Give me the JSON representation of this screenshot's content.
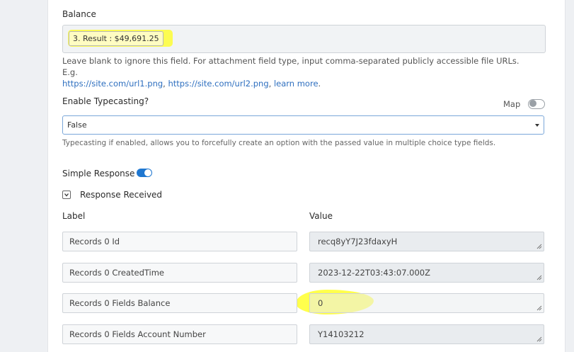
{
  "balance": {
    "label": "Balance",
    "pill": "3. Result : $49,691.25",
    "help_text": "Leave blank to ignore this field. For attachment field type, input comma-separated publicly accessible file URLs. E.g.",
    "link1": "https://site.com/url1.png",
    "sep": ", ",
    "link2": "https://site.com/url2.png",
    "link3": "learn more",
    "end": "."
  },
  "typecasting": {
    "label": "Enable Typecasting?",
    "map_label": "Map",
    "map_toggle_on": false,
    "selected": "False",
    "help_text": "Typecasting if enabled, allows you to forcefully create an option with the passed value in multiple choice type fields."
  },
  "simple_response": {
    "label": "Simple Response",
    "on": true
  },
  "response_received": {
    "label": "Response Received",
    "expanded": true
  },
  "table": {
    "label_header": "Label",
    "value_header": "Value",
    "rows": [
      {
        "label": "Records 0 Id",
        "value": "recq8yY7J23fdaxyH"
      },
      {
        "label": "Records 0 CreatedTime",
        "value": "2023-12-22T03:43:07.000Z"
      },
      {
        "label": "Records 0 Fields Balance",
        "value": "0"
      },
      {
        "label": "Records 0 Fields Account Number",
        "value": "Y14103212"
      }
    ]
  },
  "colors": {
    "accent": "#1f77d0",
    "highlight": "#ffff1a",
    "link": "#2e6fbf"
  }
}
